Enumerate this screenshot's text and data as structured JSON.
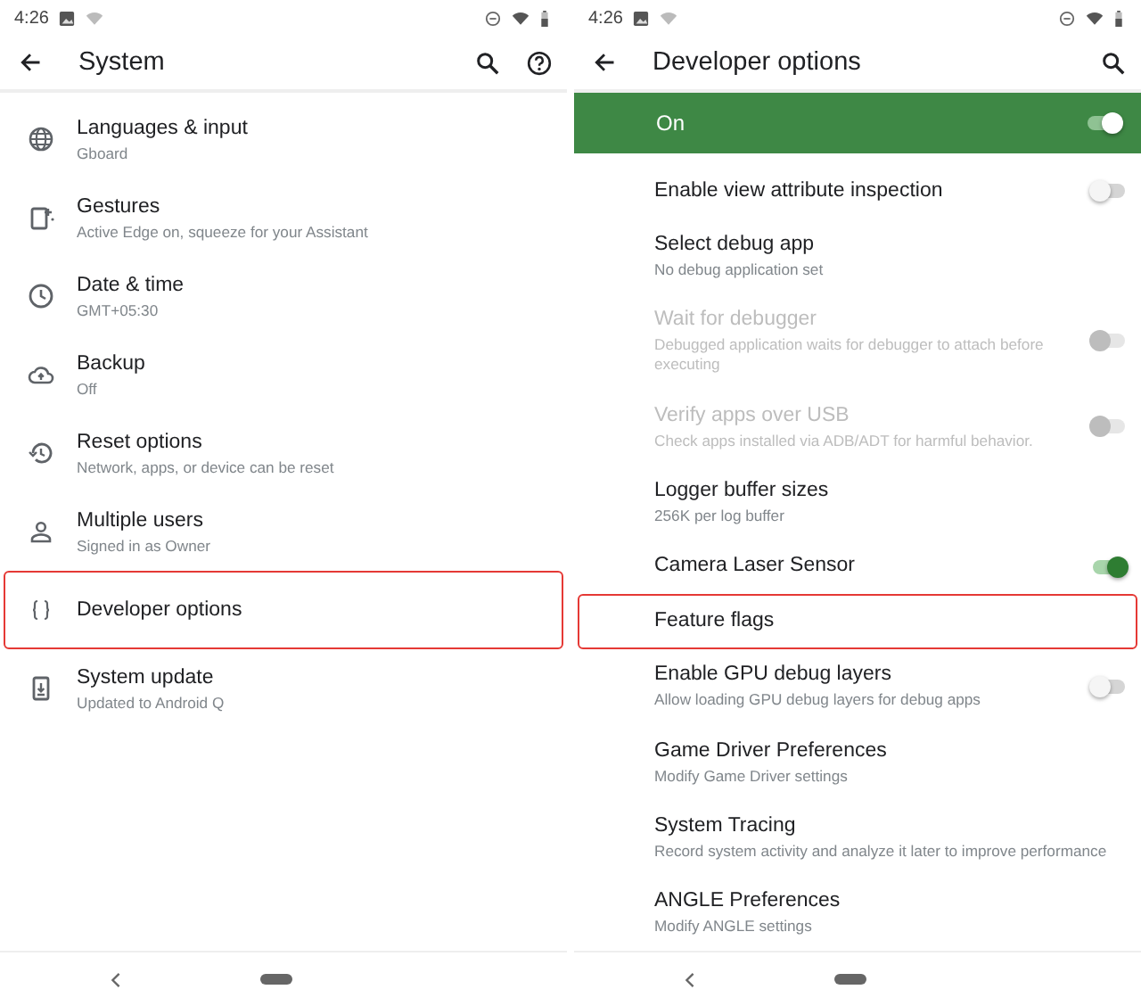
{
  "screens": [
    {
      "status_bar": {
        "time": "4:26"
      },
      "title": "System",
      "items": [
        {
          "title": "Languages & input",
          "subtitle": "Gboard",
          "highlighted": false
        },
        {
          "title": "Gestures",
          "subtitle": "Active Edge on, squeeze for your Assistant",
          "highlighted": false
        },
        {
          "title": "Date & time",
          "subtitle": "GMT+05:30",
          "highlighted": false
        },
        {
          "title": "Backup",
          "subtitle": "Off",
          "highlighted": false
        },
        {
          "title": "Reset options",
          "subtitle": "Network, apps, or device can be reset",
          "highlighted": false
        },
        {
          "title": "Multiple users",
          "subtitle": "Signed in as Owner",
          "highlighted": false
        },
        {
          "title": "Developer options",
          "highlighted": true
        },
        {
          "title": "System update",
          "subtitle": "Updated to Android Q",
          "highlighted": false
        }
      ]
    },
    {
      "status_bar": {
        "time": "4:26"
      },
      "title": "Developer options",
      "master_switch": {
        "label": "On",
        "on": true
      },
      "items": [
        {
          "kind": "switch",
          "title": "Enable view attribute inspection",
          "on": false,
          "disabled": false,
          "highlighted": false
        },
        {
          "kind": "plain",
          "title": "Select debug app",
          "subtitle": "No debug application set",
          "disabled": false,
          "highlighted": false
        },
        {
          "kind": "switch",
          "title": "Wait for debugger",
          "subtitle": "Debugged application waits for debugger to attach before executing",
          "on": false,
          "disabled": true,
          "highlighted": false
        },
        {
          "kind": "switch",
          "title": "Verify apps over USB",
          "subtitle": "Check apps installed via ADB/ADT for harmful behavior.",
          "on": false,
          "disabled": true,
          "highlighted": false
        },
        {
          "kind": "plain",
          "title": "Logger buffer sizes",
          "subtitle": "256K per log buffer",
          "disabled": false,
          "highlighted": false
        },
        {
          "kind": "switch",
          "title": "Camera Laser Sensor",
          "on": true,
          "disabled": false,
          "highlighted": false
        },
        {
          "kind": "plain",
          "title": "Feature flags",
          "disabled": false,
          "highlighted": true
        },
        {
          "kind": "switch",
          "title": "Enable GPU debug layers",
          "subtitle": "Allow loading GPU debug layers for debug apps",
          "on": false,
          "disabled": false,
          "highlighted": false
        },
        {
          "kind": "plain",
          "title": "Game Driver Preferences",
          "subtitle": "Modify Game Driver settings",
          "disabled": false,
          "highlighted": false
        },
        {
          "kind": "plain",
          "title": "System Tracing",
          "subtitle": "Record system activity and analyze it later to improve performance",
          "disabled": false,
          "highlighted": false
        },
        {
          "kind": "plain",
          "title": "ANGLE Preferences",
          "subtitle": "Modify ANGLE settings",
          "disabled": false,
          "highlighted": false
        }
      ]
    }
  ]
}
